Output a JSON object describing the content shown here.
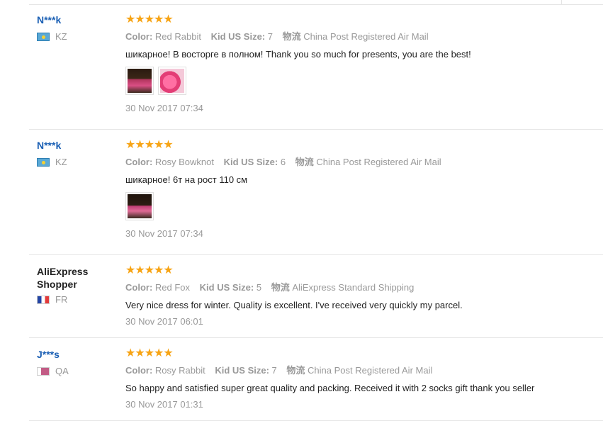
{
  "labels": {
    "color": "Color:",
    "size": "Kid US Size:",
    "shipping": "物流"
  },
  "stars": "★★★★★",
  "reviews": [
    {
      "name": "N***k",
      "country": "KZ",
      "color": "Red Rabbit",
      "size": "7",
      "shipping": "China Post Registered Air Mail",
      "text": "шикарное! В восторге в полном! Thank you so much for presents, you are the best!",
      "date": "30 Nov 2017 07:34"
    },
    {
      "name": "N***k",
      "country": "KZ",
      "color": "Rosy Bowknot",
      "size": "6",
      "shipping": "China Post Registered Air Mail",
      "text": "шикарное! 6т на рост 110 см",
      "date": "30 Nov 2017 07:34"
    },
    {
      "name": "AliExpress Shopper",
      "country": "FR",
      "color": "Red Fox",
      "size": "5",
      "shipping": "AliExpress Standard Shipping",
      "text": "Very nice dress for winter. Quality is excellent. I've received very quickly my parcel.",
      "date": "30 Nov 2017 06:01"
    },
    {
      "name": "J***s",
      "country": "QA",
      "color": "Rosy Rabbit",
      "size": "7",
      "shipping": "China Post Registered Air Mail",
      "text": "So happy and satisfied super great quality and packing. Received it with 2 socks gift thank you seller",
      "date": "30 Nov 2017 01:31"
    }
  ],
  "rating": "5/5"
}
